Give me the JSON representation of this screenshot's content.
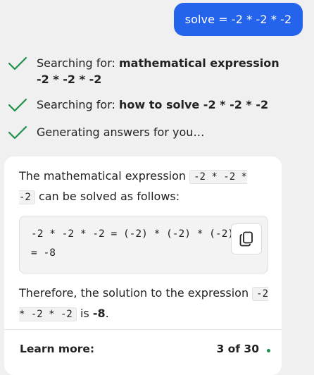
{
  "user_message": "solve = -2 * -2 * -2",
  "colors": {
    "user_bubble": "#2463eb",
    "check": "#1c8f4a"
  },
  "status_items": [
    {
      "icon": "check-icon",
      "prefix": "Searching for: ",
      "bold": "mathematical expression -2 * -2 * -2"
    },
    {
      "icon": "check-icon",
      "prefix": "Searching for: ",
      "bold": "how to solve -2 * -2 * -2"
    },
    {
      "icon": "check-icon",
      "prefix": "Generating answers for you…",
      "bold": ""
    }
  ],
  "answer": {
    "intro_prefix": "The mathematical expression ",
    "intro_code": "-2 * -2 * -2",
    "intro_suffix": " can be solved as follows:",
    "code_line1": "-2 * -2 * -2 = (-2) * (-2) * (-2)",
    "code_line2": "= -8",
    "copy_icon": "copy-icon",
    "conclusion_prefix": "Therefore, the solution to the expression ",
    "conclusion_code": "-2 * -2 * -2",
    "conclusion_mid": " is ",
    "conclusion_bold": "-8",
    "conclusion_end": "."
  },
  "footer": {
    "learn_more": "Learn more:",
    "count": "3 of 30"
  }
}
